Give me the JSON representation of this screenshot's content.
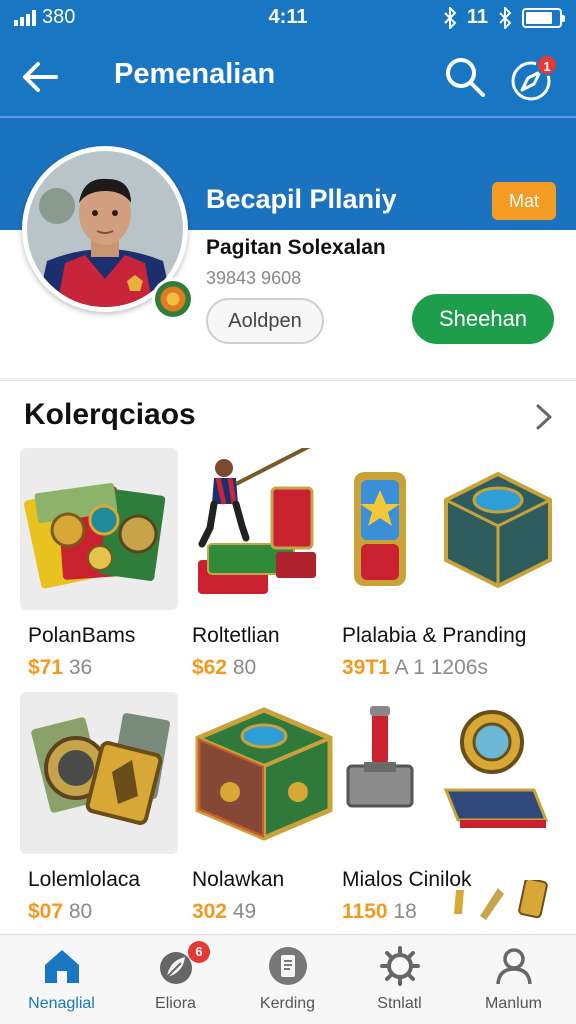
{
  "status_bar": {
    "signal_text": "380",
    "time": "4:11",
    "right_text": "11"
  },
  "app_bar": {
    "title": "Pemenalian",
    "notification_count": "1"
  },
  "profile": {
    "name": "Becapil Pllaniy",
    "level_badge": "Mat",
    "subtitle": "Pagitan Solexalan",
    "id_number": "39843 9608",
    "outline_button": "Aoldpen",
    "primary_button": "Sheehan"
  },
  "collections": {
    "title": "Kolerqciaos",
    "items": [
      {
        "name": "PolanBams",
        "price_currency": "$71",
        "price_rest": " 36"
      },
      {
        "name": "Roltetlian",
        "price_currency": "$62",
        "price_rest": " 80"
      },
      {
        "name": "Plalabia & Pranding",
        "price_currency": "39T1",
        "price_rest": " A 1 1206s"
      },
      {
        "name": "Lolemlolaca",
        "price_currency": "$07",
        "price_rest": " 80"
      },
      {
        "name": "Nolawkan",
        "price_currency": "302",
        "price_rest": " 49"
      },
      {
        "name": "Mialos Cinilok",
        "price_currency": "1150",
        "price_rest": " 18"
      }
    ]
  },
  "tab_bar": {
    "tabs": [
      {
        "label": "Nenaglial",
        "icon": "home-icon"
      },
      {
        "label": "Eliora",
        "icon": "leaf-icon",
        "badge": "6"
      },
      {
        "label": "Kerding",
        "icon": "tablet-icon"
      },
      {
        "label": "Stnlatl",
        "icon": "gear-icon"
      },
      {
        "label": "Manlum",
        "icon": "user-icon"
      }
    ]
  },
  "colors": {
    "primary_blue": "#1876c2",
    "accent_orange": "#f39b22",
    "success_green": "#1e9e4a",
    "badge_red": "#e53935"
  }
}
